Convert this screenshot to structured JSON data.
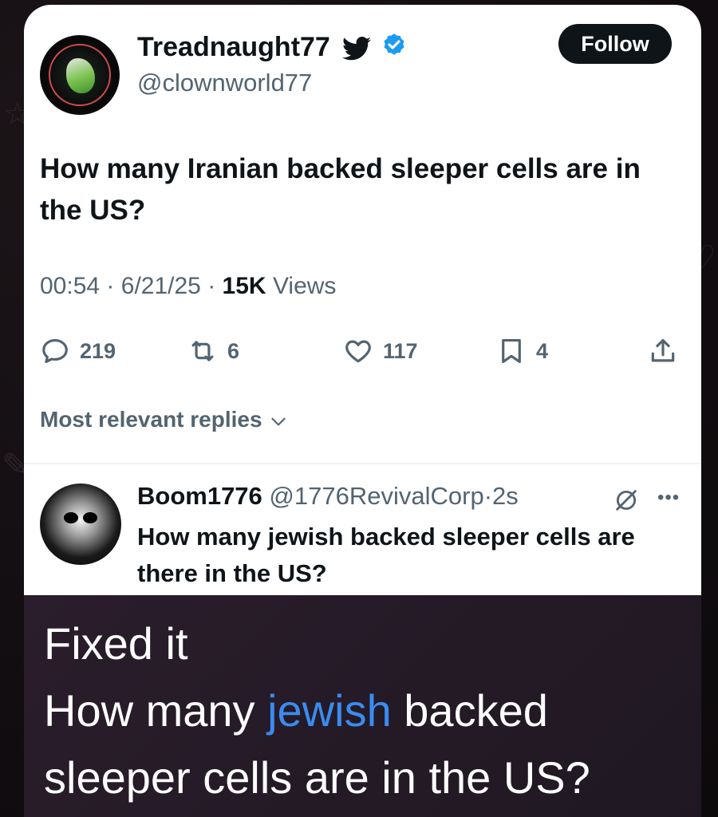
{
  "tweet": {
    "display_name": "Treadnaught77",
    "handle": "@clownworld77",
    "follow_label": "Follow",
    "text": "How many Iranian backed sleeper cells are in the US?",
    "time": "00:54",
    "date": "6/21/25",
    "separator": "·",
    "views_count": "15K",
    "views_label": "Views",
    "replies": "219",
    "retweets": "6",
    "likes": "117",
    "bookmarks": "4"
  },
  "replies_sort": {
    "label": "Most relevant replies"
  },
  "reply": {
    "display_name": "Boom1776",
    "handle": "@1776RevivalCorp",
    "separator": "·",
    "age": "2s",
    "text": "How many jewish backed sleeper cells are there in the US?"
  },
  "caption": {
    "line1": "Fixed it",
    "line2_prefix": "How many ",
    "line2_highlight": "jewish",
    "line2_suffix": " backed",
    "line3": "sleeper cells are in the US?",
    "highlight_color": "#3a8cf0"
  },
  "icons": {
    "platform": "bird-icon",
    "verified": "verified-badge-icon",
    "reply": "reply-icon",
    "retweet": "retweet-icon",
    "like": "heart-icon",
    "bookmark": "bookmark-icon",
    "share": "share-icon",
    "grok": "grok-icon",
    "more": "more-icon",
    "sort": "chevron-down-icon"
  },
  "colors": {
    "accent": "#1d9bf0",
    "text": "#0f1419",
    "secondary": "#536471"
  }
}
